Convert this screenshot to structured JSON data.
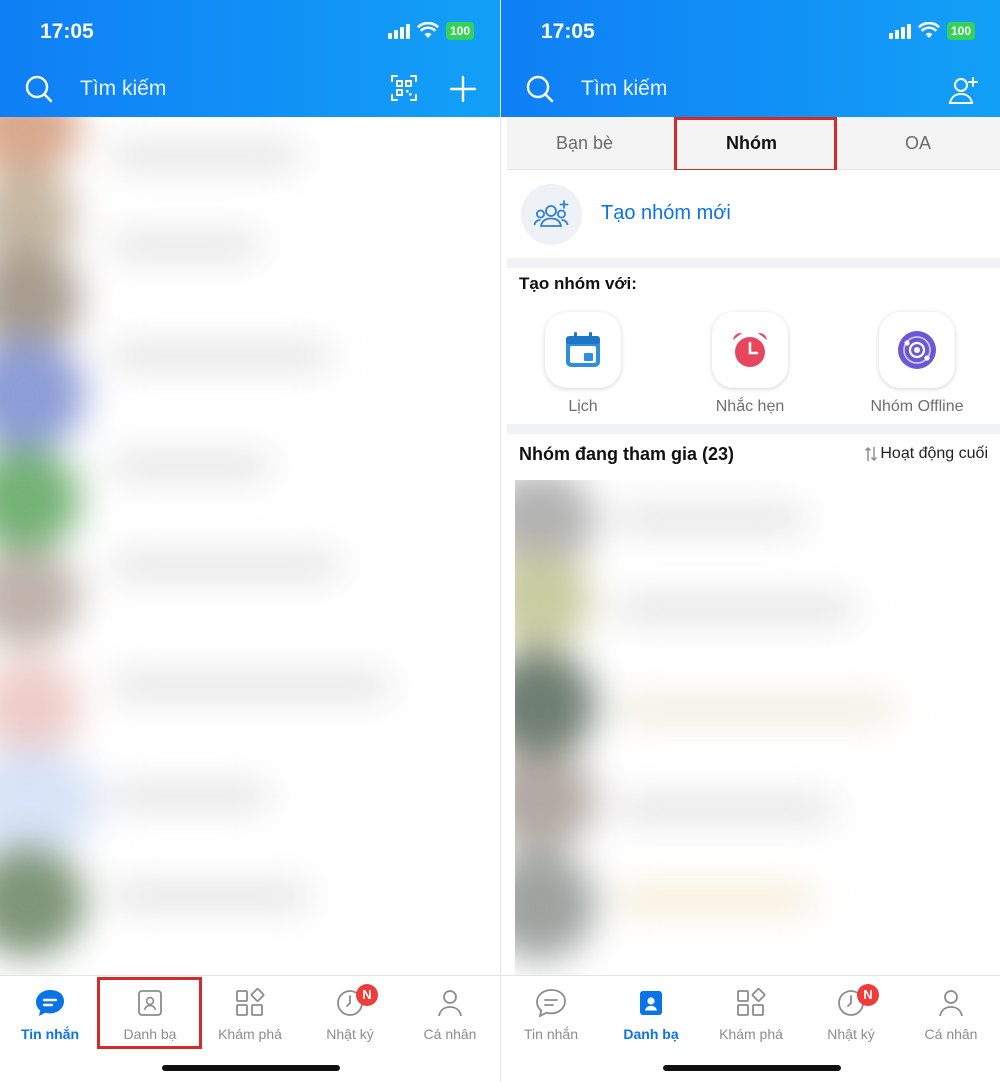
{
  "left": {
    "status": {
      "time": "17:05",
      "battery": "100"
    },
    "header": {
      "search_placeholder": "Tìm kiếm"
    },
    "tabs": [
      {
        "label": "Tin nhắn",
        "icon": "chat-bubble-icon",
        "active": true
      },
      {
        "label": "Danh bạ",
        "icon": "contacts-icon",
        "active": false
      },
      {
        "label": "Khám phá",
        "icon": "grid-icon",
        "active": false
      },
      {
        "label": "Nhật ký",
        "icon": "clock-icon",
        "active": false,
        "badge": "N"
      },
      {
        "label": "Cá nhân",
        "icon": "person-icon",
        "active": false
      }
    ]
  },
  "right": {
    "status": {
      "time": "17:05",
      "battery": "100"
    },
    "header": {
      "search_placeholder": "Tìm kiếm"
    },
    "segments": [
      {
        "label": "Bạn bè",
        "active": false
      },
      {
        "label": "Nhóm",
        "active": true
      },
      {
        "label": "OA",
        "active": false
      }
    ],
    "create_group": "Tạo nhóm mới",
    "create_with_title": "Tạo nhóm với:",
    "create_with_options": [
      {
        "label": "Lịch",
        "icon": "calendar-icon"
      },
      {
        "label": "Nhắc hẹn",
        "icon": "alarm-clock-icon"
      },
      {
        "label": "Nhóm Offline",
        "icon": "orbit-icon"
      }
    ],
    "joined_title": "Nhóm đang tham gia (23)",
    "sort_label": "Hoạt động cuối",
    "tabs": [
      {
        "label": "Tin nhắn",
        "icon": "chat-bubble-icon",
        "active": false
      },
      {
        "label": "Danh bạ",
        "icon": "contacts-icon",
        "active": true
      },
      {
        "label": "Khám phá",
        "icon": "grid-icon",
        "active": false
      },
      {
        "label": "Nhật ký",
        "icon": "clock-icon",
        "active": false,
        "badge": "N"
      },
      {
        "label": "Cá nhân",
        "icon": "person-icon",
        "active": false
      }
    ]
  },
  "colors": {
    "header_start": "#0f7ff5",
    "header_end": "#12a0f7",
    "accent": "#0a73e8",
    "highlight_box": "#d42a2a",
    "badge": "#f03b3b"
  }
}
